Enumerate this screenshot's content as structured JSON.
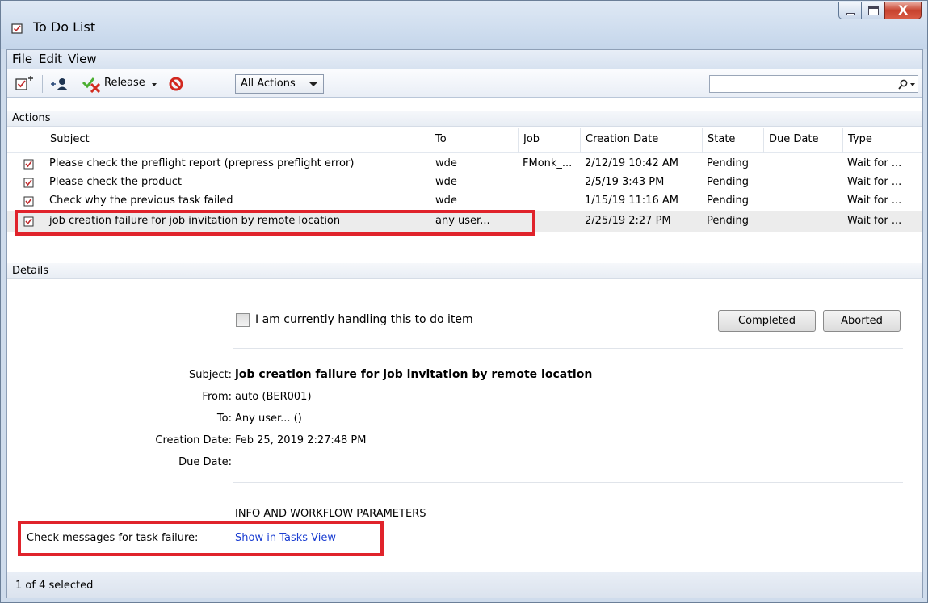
{
  "window": {
    "title": "To Do List"
  },
  "menu": {
    "file": "File",
    "edit": "Edit",
    "view": "View"
  },
  "toolbar": {
    "release_label": "Release",
    "filter_selected": "All Actions",
    "search_placeholder": ""
  },
  "actions_section": {
    "label": "Actions"
  },
  "columns": [
    "Subject",
    "To",
    "Job",
    "Creation Date",
    "State",
    "Due Date",
    "Type"
  ],
  "rows": [
    {
      "subject": "Please check the preflight report (prepress preflight error)",
      "to": "wde",
      "job": "FMonk_...",
      "created": "2/12/19 10:42 AM",
      "state": "Pending",
      "due": "",
      "type": "Wait for ..."
    },
    {
      "subject": "Please check the product",
      "to": "wde",
      "job": "",
      "created": "2/5/19 3:43 PM",
      "state": "Pending",
      "due": "",
      "type": "Wait for ..."
    },
    {
      "subject": "Check why the previous task failed",
      "to": "wde",
      "job": "",
      "created": "1/15/19 11:16 AM",
      "state": "Pending",
      "due": "",
      "type": "Wait for ..."
    },
    {
      "subject": "job creation failure for job invitation by remote location",
      "to": "any user...",
      "job": "",
      "created": "2/25/19 2:27 PM",
      "state": "Pending",
      "due": "",
      "type": "Wait for ..."
    }
  ],
  "details_section": {
    "label": "Details"
  },
  "details": {
    "handling_label": "I am currently handling this to do item",
    "completed_button": "Completed",
    "aborted_button": "Aborted",
    "subject_label": "Subject:",
    "subject_value": "job creation failure for job invitation by remote location",
    "from_label": "From:",
    "from_value": "auto (BER001)",
    "to_label": "To:",
    "to_value": "Any user... ()",
    "creation_label": "Creation Date:",
    "creation_value": "Feb 25, 2019 2:27:48 PM",
    "due_label": "Due Date:",
    "due_value": "",
    "params_heading": "INFO AND WORKFLOW PARAMETERS",
    "check_messages_label": "Check messages for task failure:",
    "show_link": "Show in Tasks View"
  },
  "status": {
    "text": "1 of 4 selected"
  },
  "colors": {
    "highlight": "#e0232b",
    "link": "#1a3dd1",
    "selected_row": "#ececec"
  }
}
